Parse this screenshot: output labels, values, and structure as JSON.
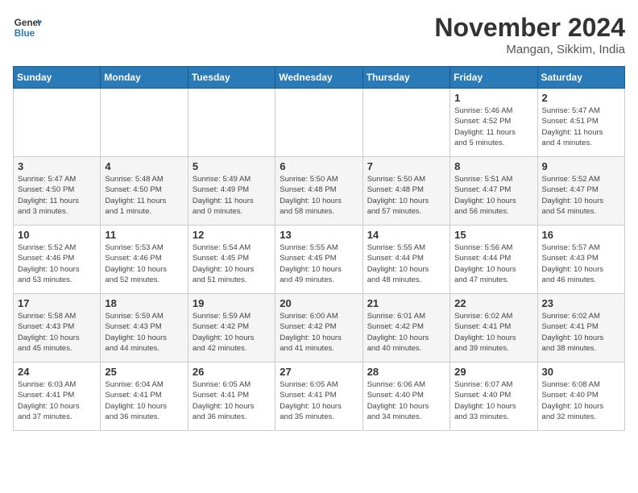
{
  "header": {
    "logo_line1": "General",
    "logo_line2": "Blue",
    "month": "November 2024",
    "location": "Mangan, Sikkim, India"
  },
  "days_of_week": [
    "Sunday",
    "Monday",
    "Tuesday",
    "Wednesday",
    "Thursday",
    "Friday",
    "Saturday"
  ],
  "weeks": [
    [
      {
        "day": "",
        "info": ""
      },
      {
        "day": "",
        "info": ""
      },
      {
        "day": "",
        "info": ""
      },
      {
        "day": "",
        "info": ""
      },
      {
        "day": "",
        "info": ""
      },
      {
        "day": "1",
        "info": "Sunrise: 5:46 AM\nSunset: 4:52 PM\nDaylight: 11 hours\nand 5 minutes."
      },
      {
        "day": "2",
        "info": "Sunrise: 5:47 AM\nSunset: 4:51 PM\nDaylight: 11 hours\nand 4 minutes."
      }
    ],
    [
      {
        "day": "3",
        "info": "Sunrise: 5:47 AM\nSunset: 4:50 PM\nDaylight: 11 hours\nand 3 minutes."
      },
      {
        "day": "4",
        "info": "Sunrise: 5:48 AM\nSunset: 4:50 PM\nDaylight: 11 hours\nand 1 minute."
      },
      {
        "day": "5",
        "info": "Sunrise: 5:49 AM\nSunset: 4:49 PM\nDaylight: 11 hours\nand 0 minutes."
      },
      {
        "day": "6",
        "info": "Sunrise: 5:50 AM\nSunset: 4:48 PM\nDaylight: 10 hours\nand 58 minutes."
      },
      {
        "day": "7",
        "info": "Sunrise: 5:50 AM\nSunset: 4:48 PM\nDaylight: 10 hours\nand 57 minutes."
      },
      {
        "day": "8",
        "info": "Sunrise: 5:51 AM\nSunset: 4:47 PM\nDaylight: 10 hours\nand 56 minutes."
      },
      {
        "day": "9",
        "info": "Sunrise: 5:52 AM\nSunset: 4:47 PM\nDaylight: 10 hours\nand 54 minutes."
      }
    ],
    [
      {
        "day": "10",
        "info": "Sunrise: 5:52 AM\nSunset: 4:46 PM\nDaylight: 10 hours\nand 53 minutes."
      },
      {
        "day": "11",
        "info": "Sunrise: 5:53 AM\nSunset: 4:46 PM\nDaylight: 10 hours\nand 52 minutes."
      },
      {
        "day": "12",
        "info": "Sunrise: 5:54 AM\nSunset: 4:45 PM\nDaylight: 10 hours\nand 51 minutes."
      },
      {
        "day": "13",
        "info": "Sunrise: 5:55 AM\nSunset: 4:45 PM\nDaylight: 10 hours\nand 49 minutes."
      },
      {
        "day": "14",
        "info": "Sunrise: 5:55 AM\nSunset: 4:44 PM\nDaylight: 10 hours\nand 48 minutes."
      },
      {
        "day": "15",
        "info": "Sunrise: 5:56 AM\nSunset: 4:44 PM\nDaylight: 10 hours\nand 47 minutes."
      },
      {
        "day": "16",
        "info": "Sunrise: 5:57 AM\nSunset: 4:43 PM\nDaylight: 10 hours\nand 46 minutes."
      }
    ],
    [
      {
        "day": "17",
        "info": "Sunrise: 5:58 AM\nSunset: 4:43 PM\nDaylight: 10 hours\nand 45 minutes."
      },
      {
        "day": "18",
        "info": "Sunrise: 5:59 AM\nSunset: 4:43 PM\nDaylight: 10 hours\nand 44 minutes."
      },
      {
        "day": "19",
        "info": "Sunrise: 5:59 AM\nSunset: 4:42 PM\nDaylight: 10 hours\nand 42 minutes."
      },
      {
        "day": "20",
        "info": "Sunrise: 6:00 AM\nSunset: 4:42 PM\nDaylight: 10 hours\nand 41 minutes."
      },
      {
        "day": "21",
        "info": "Sunrise: 6:01 AM\nSunset: 4:42 PM\nDaylight: 10 hours\nand 40 minutes."
      },
      {
        "day": "22",
        "info": "Sunrise: 6:02 AM\nSunset: 4:41 PM\nDaylight: 10 hours\nand 39 minutes."
      },
      {
        "day": "23",
        "info": "Sunrise: 6:02 AM\nSunset: 4:41 PM\nDaylight: 10 hours\nand 38 minutes."
      }
    ],
    [
      {
        "day": "24",
        "info": "Sunrise: 6:03 AM\nSunset: 4:41 PM\nDaylight: 10 hours\nand 37 minutes."
      },
      {
        "day": "25",
        "info": "Sunrise: 6:04 AM\nSunset: 4:41 PM\nDaylight: 10 hours\nand 36 minutes."
      },
      {
        "day": "26",
        "info": "Sunrise: 6:05 AM\nSunset: 4:41 PM\nDaylight: 10 hours\nand 36 minutes."
      },
      {
        "day": "27",
        "info": "Sunrise: 6:05 AM\nSunset: 4:41 PM\nDaylight: 10 hours\nand 35 minutes."
      },
      {
        "day": "28",
        "info": "Sunrise: 6:06 AM\nSunset: 4:40 PM\nDaylight: 10 hours\nand 34 minutes."
      },
      {
        "day": "29",
        "info": "Sunrise: 6:07 AM\nSunset: 4:40 PM\nDaylight: 10 hours\nand 33 minutes."
      },
      {
        "day": "30",
        "info": "Sunrise: 6:08 AM\nSunset: 4:40 PM\nDaylight: 10 hours\nand 32 minutes."
      }
    ]
  ]
}
